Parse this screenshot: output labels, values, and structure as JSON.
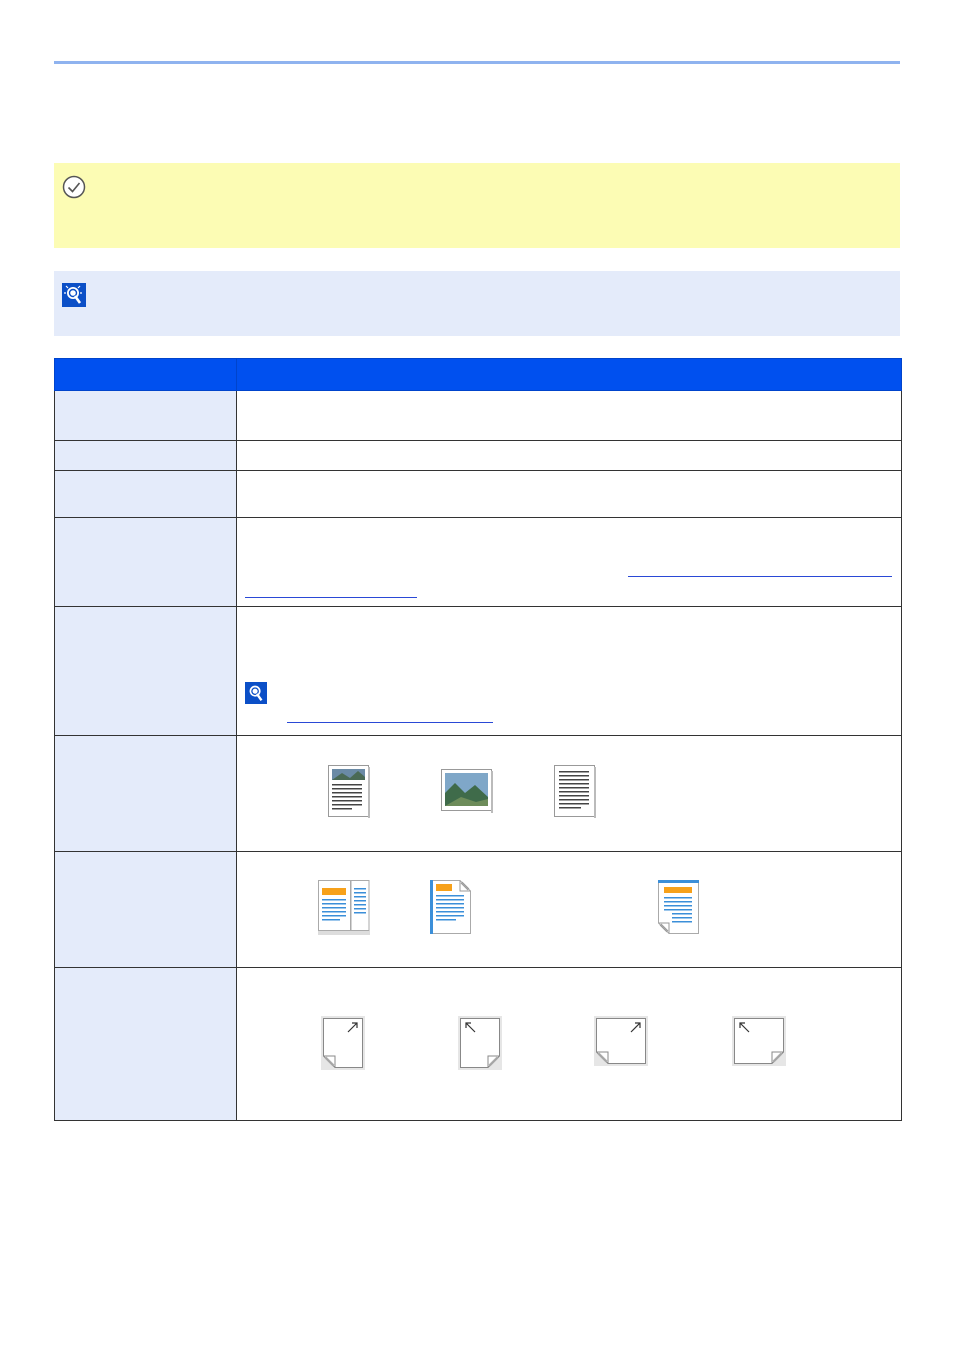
{
  "page": {
    "header_rule_color": "#8fb3ef"
  },
  "important_callout": {
    "icon": "checkmark-circle-icon",
    "background": "#fcfcb4"
  },
  "note_callout": {
    "icon": "note-lightbulb-icon",
    "background": "#e4ebfa"
  },
  "settings_table": {
    "header_background": "#0050ef",
    "rows": [
      {
        "name": "row-1"
      },
      {
        "name": "row-2"
      },
      {
        "name": "row-3"
      },
      {
        "name": "row-4",
        "has_link": true
      },
      {
        "name": "row-5",
        "has_note": true,
        "has_link": true
      },
      {
        "name": "row-6",
        "thumbnails": [
          "text-and-photo-icon",
          "photo-icon",
          "text-icon"
        ]
      },
      {
        "name": "row-7",
        "thumbnails": [
          "two-sided-book-icon",
          "two-sided-top-bound-icon",
          "top-edge-binding-icon"
        ]
      },
      {
        "name": "row-8",
        "thumbnails": [
          "portrait-top-right-icon",
          "portrait-top-left-icon",
          "landscape-top-right-icon",
          "landscape-top-left-icon"
        ]
      }
    ]
  }
}
